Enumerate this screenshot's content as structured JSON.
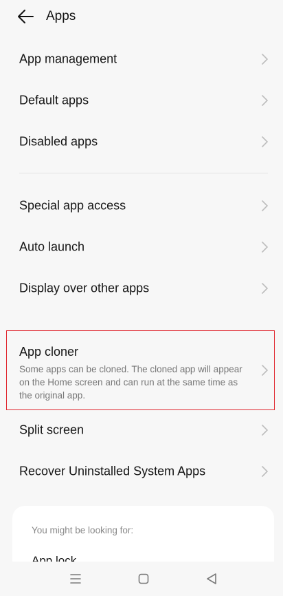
{
  "header": {
    "title": "Apps",
    "back_icon": "arrow-left-icon"
  },
  "group1": {
    "items": [
      {
        "label": "App management"
      },
      {
        "label": "Default apps"
      },
      {
        "label": "Disabled apps"
      }
    ]
  },
  "group2": {
    "items": [
      {
        "label": "Special app access"
      },
      {
        "label": "Auto launch"
      },
      {
        "label": "Display over other apps"
      }
    ]
  },
  "app_cloner": {
    "title": "App cloner",
    "description": "Some apps can be cloned. The cloned app will appear on the Home screen and can run at the same time as the original app."
  },
  "group3": {
    "items": [
      {
        "label": "Split screen"
      },
      {
        "label": "Recover Uninstalled System Apps"
      }
    ]
  },
  "suggestions": {
    "heading": "You might be looking for:",
    "items": [
      {
        "label": "App lock"
      }
    ]
  },
  "navbar": {
    "icons": [
      "menu-icon",
      "home-icon",
      "back-triangle-icon"
    ]
  },
  "colors": {
    "background": "#f7f7f7",
    "highlight_border": "#e0242c",
    "secondary_text": "#777777"
  }
}
